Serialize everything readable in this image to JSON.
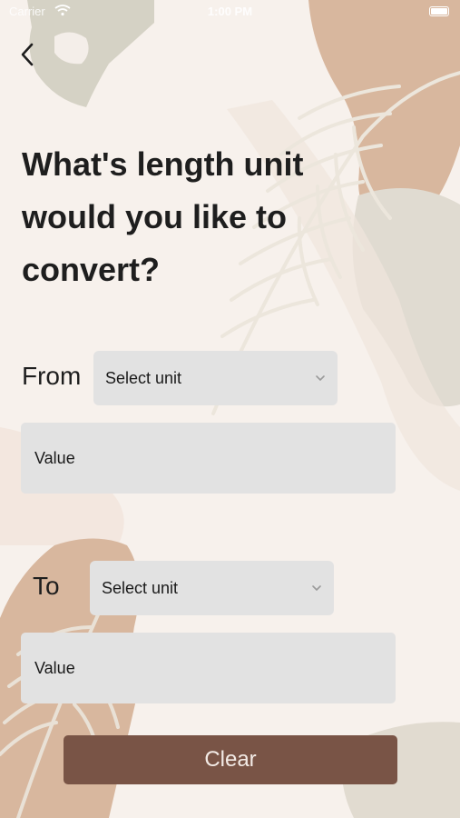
{
  "status_bar": {
    "carrier": "Carrier",
    "time": "1:00 PM"
  },
  "back_icon": "chevron-left-icon",
  "title": "What's length unit\nwould you like to\nconvert?",
  "from": {
    "label": "From",
    "select_placeholder": "Select unit",
    "value_placeholder": "Value"
  },
  "to": {
    "label": "To",
    "select_placeholder": "Select unit",
    "value_placeholder": "Value"
  },
  "clear_button_label": "Clear",
  "colors": {
    "background": "#f7f1ec",
    "field": "#e2e2e2",
    "button": "#795446",
    "button_text": "#f3ebe6",
    "text": "#1e1e1e"
  }
}
